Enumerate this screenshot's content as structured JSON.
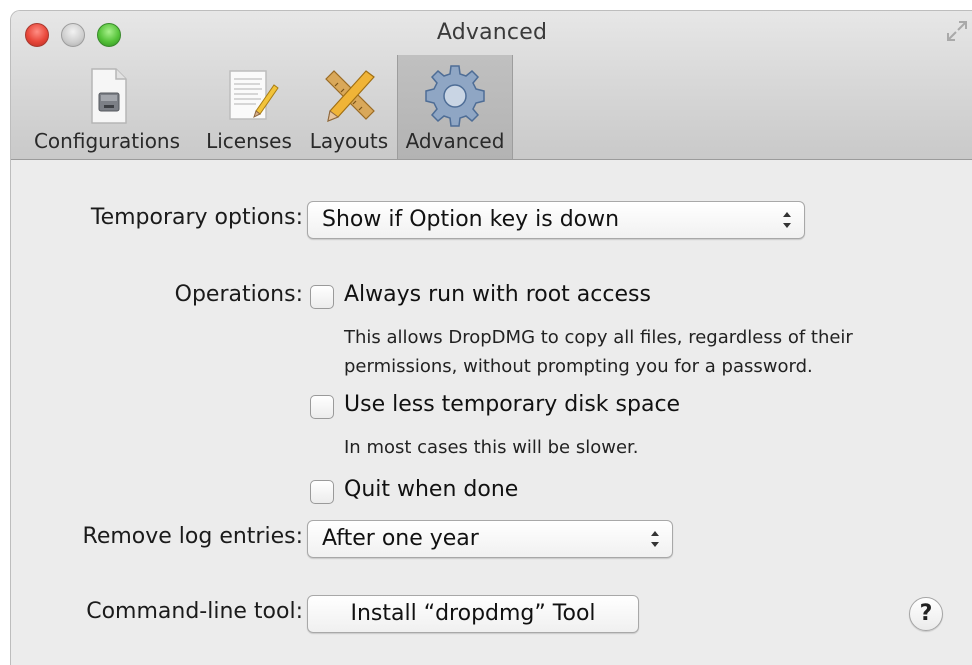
{
  "window": {
    "title": "Advanced"
  },
  "toolbar": {
    "items": [
      {
        "label": "Configurations",
        "icon": "disk-image-icon"
      },
      {
        "label": "Licenses",
        "icon": "license-document-icon"
      },
      {
        "label": "Layouts",
        "icon": "ruler-pencil-icon"
      },
      {
        "label": "Advanced",
        "icon": "gear-icon",
        "selected": true
      }
    ]
  },
  "settings": {
    "temporary_options_label": "Temporary options:",
    "temporary_options_value": "Show if Option key is down",
    "operations_label": "Operations:",
    "root_access_label": "Always run with root access",
    "root_access_checked": false,
    "root_access_note_line1": "This allows DropDMG to copy all files, regardless of their",
    "root_access_note_line2": "permissions, without prompting you for a password.",
    "less_disk_label": "Use less temporary disk space",
    "less_disk_checked": false,
    "less_disk_note": "In most cases this will be slower.",
    "quit_label": "Quit when done",
    "quit_checked": false,
    "remove_log_label": "Remove log entries:",
    "remove_log_value": "After one year",
    "command_line_label": "Command-line tool:",
    "install_button_label": "Install “dropdmg” Tool",
    "help_label": "?"
  },
  "colors": {
    "toolbar_selected": "#b8b8b8",
    "window_background": "#ececec",
    "close_button": "#e8473a",
    "zoom_button": "#56c33a"
  }
}
